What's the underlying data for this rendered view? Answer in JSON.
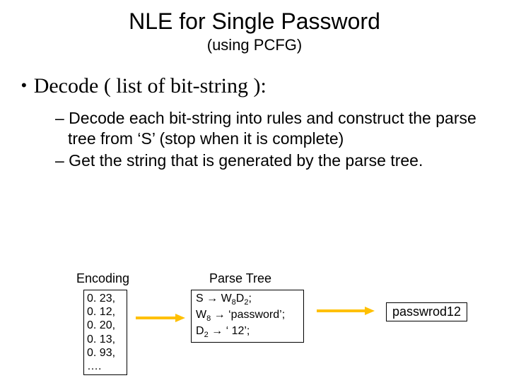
{
  "title": "NLE for Single Password",
  "subtitle": "(using PCFG)",
  "bullet": "Decode ( list of bit-string ):",
  "sub1": "– Decode each bit-string into rules and construct the parse tree from ‘S’ (stop when it is complete)",
  "sub2": "– Get the string that is generated by the parse tree.",
  "encodingLabel": "Encoding",
  "encodingBox": "0. 23, 0. 12, 0. 20, 0. 13, 0. 93, ….",
  "parseLabel": "Parse Tree",
  "pt_line1_a": "S    → W",
  "pt_line1_b": "D",
  "pt_line1_c": ";",
  "pt_line2_a": "W",
  "pt_line2_b": " → ‘password’;",
  "pt_line3_a": "D",
  "pt_line3_b": " → ‘ 12’;",
  "sub_8": "8",
  "sub_2": "2",
  "result": "passwrod12"
}
